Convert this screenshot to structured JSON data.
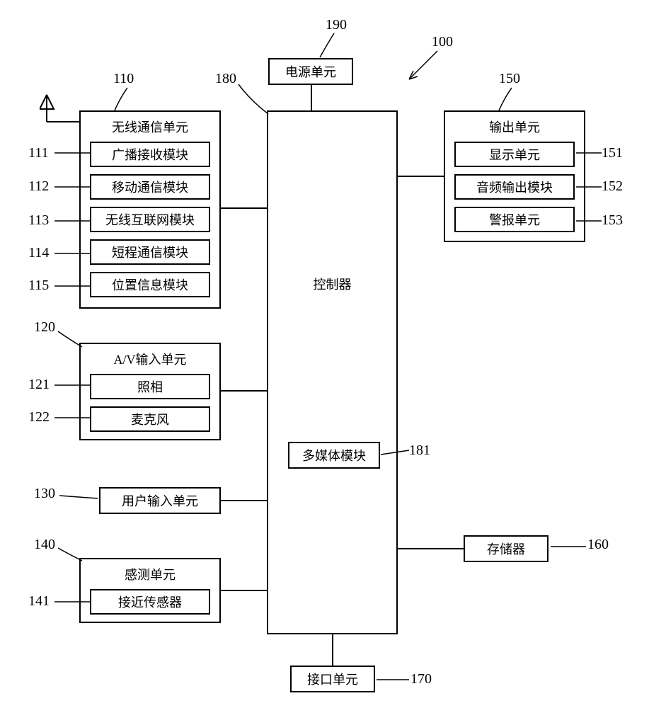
{
  "refs": {
    "r100": "100",
    "r110": "110",
    "r111": "111",
    "r112": "112",
    "r113": "113",
    "r114": "114",
    "r115": "115",
    "r120": "120",
    "r121": "121",
    "r122": "122",
    "r130": "130",
    "r140": "140",
    "r141": "141",
    "r150": "150",
    "r151": "151",
    "r152": "152",
    "r153": "153",
    "r160": "160",
    "r170": "170",
    "r180": "180",
    "r181": "181",
    "r190": "190"
  },
  "blocks": {
    "power_supply": "电源单元",
    "wireless_comm": "无线通信单元",
    "broadcast_rx": "广播接收模块",
    "mobile_comm": "移动通信模块",
    "wireless_internet": "无线互联网模块",
    "short_range": "短程通信模块",
    "location_info": "位置信息模块",
    "av_input": "A/V输入单元",
    "camera": "照相",
    "microphone": "麦克风",
    "user_input": "用户输入单元",
    "sensing": "感测单元",
    "proximity": "接近传感器",
    "controller": "控制器",
    "multimedia": "多媒体模块",
    "output": "输出单元",
    "display": "显示单元",
    "audio_out": "音频输出模块",
    "alarm": "警报单元",
    "memory": "存储器",
    "interface": "接口单元"
  }
}
